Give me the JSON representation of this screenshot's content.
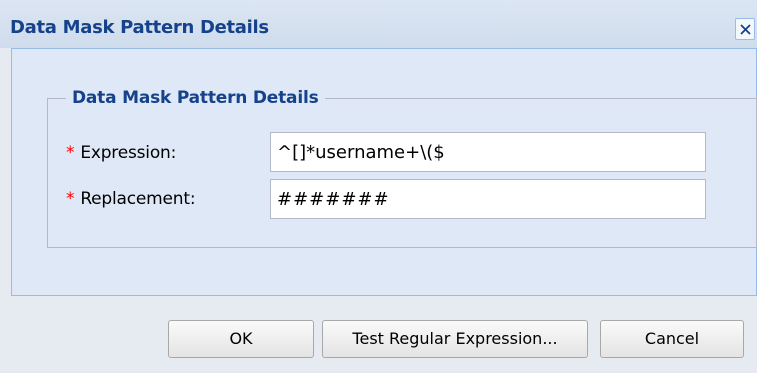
{
  "dialog": {
    "title": "Data Mask Pattern Details",
    "close_icon": "close-icon"
  },
  "fieldset": {
    "legend": "Data Mask Pattern Details",
    "fields": [
      {
        "required_marker": "*",
        "label": "Expression:",
        "value": "^[]*username+\\($"
      },
      {
        "required_marker": "*",
        "label": "Replacement:",
        "value": "#######"
      }
    ]
  },
  "buttons": {
    "ok": "OK",
    "test": "Test Regular Expression...",
    "cancel": "Cancel"
  },
  "colors": {
    "title_text": "#15428b",
    "required_marker": "#ff0000",
    "panel_background": "#dfe8f6",
    "panel_border": "#99bbe8"
  }
}
